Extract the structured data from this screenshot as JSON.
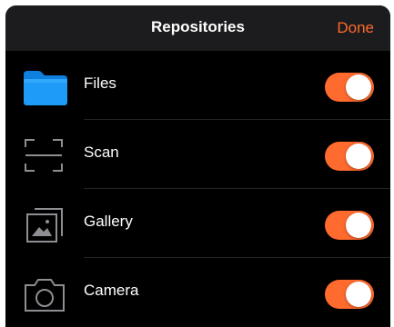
{
  "header": {
    "title": "Repositories",
    "done_label": "Done"
  },
  "colors": {
    "accent": "#ff6a2e",
    "header_bg": "#1c1c1e",
    "list_bg": "#000000",
    "folder_blue": "#1e9bf6"
  },
  "repositories": [
    {
      "label": "Files",
      "icon": "folder-icon",
      "enabled": true
    },
    {
      "label": "Scan",
      "icon": "scan-icon",
      "enabled": true
    },
    {
      "label": "Gallery",
      "icon": "gallery-icon",
      "enabled": true
    },
    {
      "label": "Camera",
      "icon": "camera-icon",
      "enabled": true
    }
  ]
}
